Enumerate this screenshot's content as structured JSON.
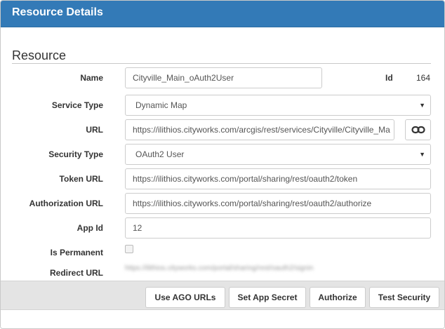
{
  "dialog": {
    "title": "Resource Details"
  },
  "section": {
    "title": "Resource"
  },
  "fields": {
    "name": {
      "label": "Name",
      "value": "Cityville_Main_oAuth2User"
    },
    "id": {
      "label": "Id",
      "value": "164"
    },
    "service_type": {
      "label": "Service Type",
      "value": "Dynamic Map"
    },
    "url": {
      "label": "URL",
      "value": "https://ilithios.cityworks.com/arcgis/rest/services/Cityville/Cityville_Ma"
    },
    "security_type": {
      "label": "Security Type",
      "value": "OAuth2 User"
    },
    "token_url": {
      "label": "Token URL",
      "value": "https://ilithios.cityworks.com/portal/sharing/rest/oauth2/token"
    },
    "authorization_url": {
      "label": "Authorization URL",
      "value": "https://ilithios.cityworks.com/portal/sharing/rest/oauth2/authorize"
    },
    "app_id": {
      "label": "App Id",
      "value": "12"
    },
    "is_permanent": {
      "label": "Is Permanent",
      "checked": false
    },
    "redirect_url": {
      "label": "Redirect URL",
      "value": "https://ilithios.cityworks.com/portal/sharing/rest/oauth2/signin"
    }
  },
  "icons": {
    "url_link": "link-icon",
    "select_caret": "caret-down-icon"
  },
  "buttons": {
    "use_ago_urls": "Use AGO URLs",
    "set_app_secret": "Set App Secret",
    "authorize": "Authorize",
    "test_security": "Test Security"
  },
  "colors": {
    "header": "#337ab7"
  }
}
